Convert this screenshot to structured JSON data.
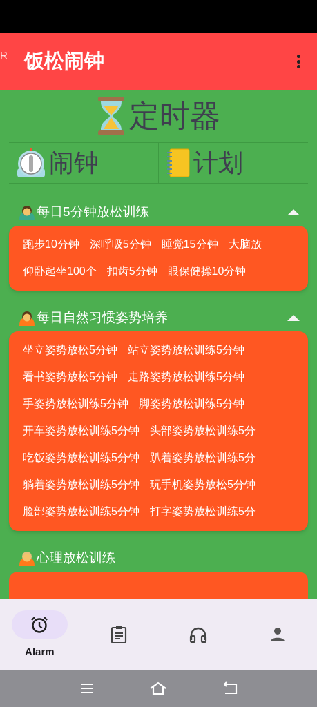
{
  "app_bar": {
    "edge_text": "R",
    "title": "饭松闹钟"
  },
  "header": {
    "title": "定时器"
  },
  "tabs": [
    {
      "label": "闹钟",
      "kind": "stopwatch"
    },
    {
      "label": "计划",
      "kind": "notebook"
    }
  ],
  "sections": [
    {
      "title": "每日5分钟放松训练",
      "kind": "man",
      "expanded": true,
      "rows": [
        [
          "跑步10分钟",
          "深呼吸5分钟",
          "睡觉15分钟",
          "大脑放"
        ],
        [
          "仰卧起坐100个",
          "扣齿5分钟",
          "眼保健操10分钟"
        ]
      ]
    },
    {
      "title": "每日自然习惯姿势培养",
      "kind": "woman",
      "expanded": true,
      "rows": [
        [
          "坐立姿势放松5分钟",
          "站立姿势放松训练5分钟"
        ],
        [
          "看书姿势放松5分钟",
          "走路姿势放松训练5分钟"
        ],
        [
          "手姿势放松训练5分钟",
          "脚姿势放松训练5分钟"
        ],
        [
          "开车姿势放松训练5分钟",
          "头部姿势放松训练5分"
        ],
        [
          "吃饭姿势放松训练5分钟",
          "趴着姿势放松训练5分"
        ],
        [
          "躺着姿势放松训练5分钟",
          "玩手机姿势放松5分钟"
        ],
        [
          "脸部姿势放松训练5分钟",
          "打字姿势放松训练5分"
        ]
      ]
    },
    {
      "title": "心理放松训练",
      "kind": "blonde"
    }
  ],
  "bottom_nav": [
    {
      "kind": "alarm",
      "label": "Alarm",
      "selected": true
    },
    {
      "kind": "clipboard",
      "selected": false
    },
    {
      "kind": "headphones",
      "selected": false
    },
    {
      "kind": "person",
      "selected": false
    }
  ]
}
